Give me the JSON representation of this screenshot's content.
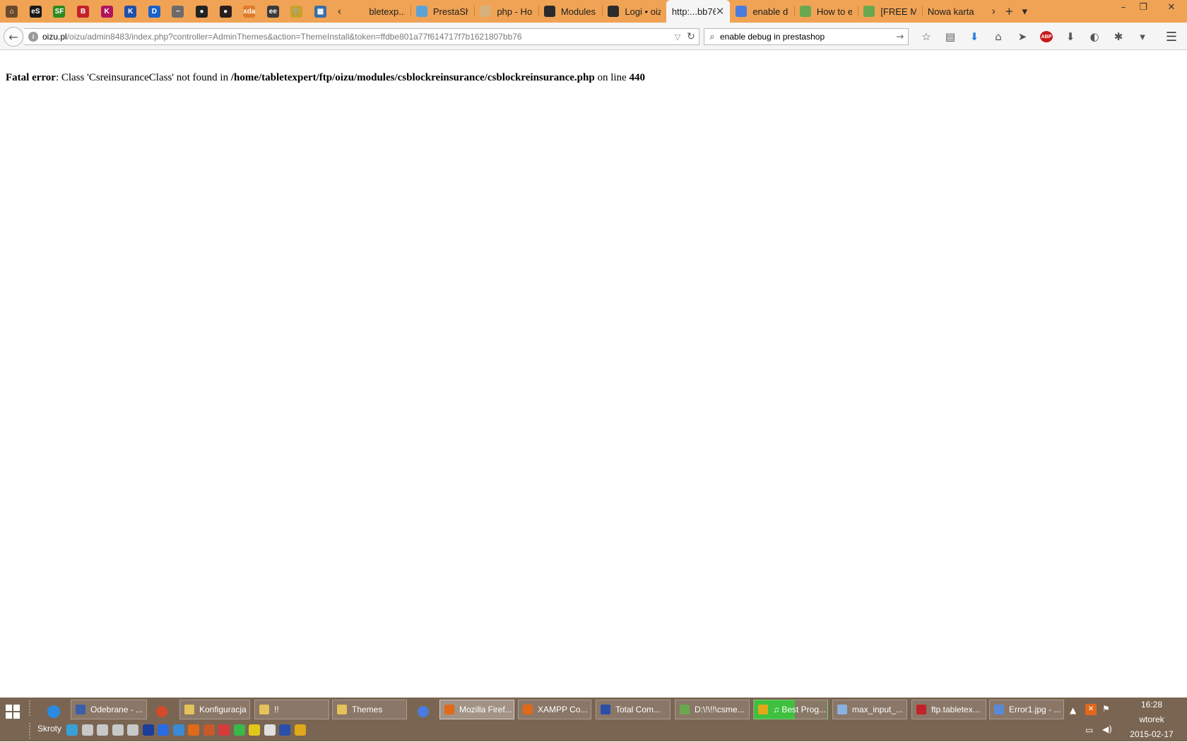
{
  "window": {
    "minimize_glyph": "–",
    "maximize_glyph": "❐",
    "close_glyph": "✕"
  },
  "tabs": {
    "pinned": [
      {
        "icon": "home-site-icon",
        "glyph": "⌂",
        "color": "#6b4a2b"
      },
      {
        "icon": "es-icon",
        "glyph": "eS",
        "color": "#1a1a1a"
      },
      {
        "icon": "sf-icon",
        "glyph": "SF",
        "color": "#2e8b20"
      },
      {
        "icon": "red-square-icon",
        "glyph": "B",
        "color": "#c3222a"
      },
      {
        "icon": "k-pink-icon",
        "glyph": "K",
        "color": "#b0165c"
      },
      {
        "icon": "k-blue-icon",
        "glyph": "K",
        "color": "#1f4fa8"
      },
      {
        "icon": "d-blue-icon",
        "glyph": "D",
        "color": "#1b62c8"
      },
      {
        "icon": "chart-icon",
        "glyph": "~",
        "color": "#6b6b6b"
      },
      {
        "icon": "eye-dark-icon",
        "glyph": "●",
        "color": "#222222"
      },
      {
        "icon": "eye-dark2-icon",
        "glyph": "●",
        "color": "#2a1d1d"
      },
      {
        "icon": "xda-icon",
        "glyph": "xda",
        "color": "#e07b2a"
      },
      {
        "icon": "ee-icon",
        "glyph": "ee",
        "color": "#3a3a3a"
      },
      {
        "icon": "cart-icon",
        "glyph": "🛒",
        "color": "#c9a12a"
      },
      {
        "icon": "landscape-icon",
        "glyph": "▦",
        "color": "#3a6ea5"
      }
    ],
    "scroll_left": "‹",
    "scroll_right": "›",
    "items": [
      {
        "label": "bletexp...",
        "icon": "tab-favicon",
        "color": "#f0a354",
        "active": false,
        "no_icon": true
      },
      {
        "label": "PrestaSh...",
        "icon": "prestashop-icon",
        "color": "#5aa3d6",
        "active": false
      },
      {
        "label": "php - Ho...",
        "icon": "php-icon",
        "color": "#d6b07a",
        "active": false
      },
      {
        "label": "Modules ...",
        "icon": "prestashop-forum-icon",
        "color": "#2b2b2b",
        "active": false
      },
      {
        "label": "Logi • oiz...",
        "icon": "logi-icon",
        "color": "#2b2b2b",
        "active": false
      },
      {
        "label": "http:...bb76",
        "icon": "",
        "color": "",
        "active": true
      },
      {
        "label": "enable de...",
        "icon": "google-icon",
        "color": "#4a7be0",
        "active": false
      },
      {
        "label": "How to e...",
        "icon": "leaf-icon",
        "color": "#6aa84f",
        "active": false
      },
      {
        "label": "[FREE M...",
        "icon": "leaf2-icon",
        "color": "#6aa84f",
        "active": false
      },
      {
        "label": "Nowa karta",
        "icon": "",
        "color": "",
        "active": false
      }
    ],
    "close_glyph": "✕",
    "new_tab": "+",
    "list_all": "▾"
  },
  "navbar": {
    "back": "←",
    "url_host": "oizu.pl",
    "url_rest": "/oizu/admin8483/index.php?controller=AdminThemes&action=ThemeInstall&token=ffdbe801a77f614717f7b1621807bb76",
    "url_dropdown": "▽",
    "reload": "↻",
    "search_value": "enable debug in prestashop",
    "search_icon": "⌕",
    "search_go": "→",
    "tools": [
      {
        "name": "bookmark-star-icon",
        "glyph": "☆"
      },
      {
        "name": "reading-list-icon",
        "glyph": "▤"
      },
      {
        "name": "download-icon",
        "glyph": "⬇",
        "color": "#2b7de0"
      },
      {
        "name": "home-icon",
        "glyph": "⌂"
      },
      {
        "name": "send-icon",
        "glyph": "➤"
      },
      {
        "name": "adblock-icon",
        "glyph": "ABP"
      },
      {
        "name": "download-helper-icon",
        "glyph": "⬇"
      },
      {
        "name": "extension-icon",
        "glyph": "◐"
      },
      {
        "name": "extension2-icon",
        "glyph": "✱"
      },
      {
        "name": "overflow-icon",
        "glyph": "▾"
      }
    ],
    "menu": "☰"
  },
  "page": {
    "error_label": "Fatal error",
    "error_msg": ": Class 'CsreinsuranceClass' not found in ",
    "error_path": "/home/tabletexpert/ftp/oizu/modules/csblockreinsurance/csblockreinsurance.php",
    "error_on_line": " on line ",
    "error_line": "440"
  },
  "taskbar": {
    "windows": [
      {
        "label": "Odebrane - ...",
        "icon": "thunderbird-icon",
        "color": "#3b5fa8"
      },
      {
        "label": "Konfiguracja",
        "icon": "folder-icon",
        "color": "#e3c35a"
      },
      {
        "label": "!!",
        "icon": "folder2-icon",
        "color": "#e3c35a"
      },
      {
        "label": "Themes",
        "icon": "folder3-icon",
        "color": "#e3c35a"
      },
      {
        "label": "Mozilla Firef...",
        "icon": "firefox-icon",
        "color": "#e06a1a",
        "active": true
      },
      {
        "label": "XAMPP Co...",
        "icon": "xampp-icon",
        "color": "#e0681a"
      },
      {
        "label": "Total Com...",
        "icon": "totalcmd-icon",
        "color": "#2a4fa8"
      },
      {
        "label": "D:\\!\\!!\\csme...",
        "icon": "notepad-icon",
        "color": "#6aa84f"
      },
      {
        "label": "♫ Best Prog...",
        "icon": "winamp-icon",
        "color": "#e0a81a",
        "green": true
      },
      {
        "label": "max_input_...",
        "icon": "text-icon",
        "color": "#8ab2e0"
      },
      {
        "label": "ftp.tabletex...",
        "icon": "filezilla-icon",
        "color": "#c3222a"
      },
      {
        "label": "Error1.jpg - ...",
        "icon": "image-viewer-icon",
        "color": "#5a8ad6"
      }
    ],
    "skroty": "Skroty",
    "clock_time": "16:28",
    "clock_day": "wtorek",
    "clock_date": "2015-02-17"
  }
}
